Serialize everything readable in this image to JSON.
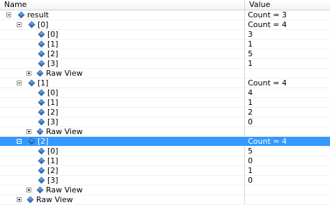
{
  "columns": {
    "name": "Name",
    "value": "Value"
  },
  "rows": [
    {
      "label": "result",
      "value": "Count = 3",
      "level": 0,
      "expander": "minus"
    },
    {
      "label": "[0]",
      "value": "Count = 4",
      "level": 1,
      "expander": "minus"
    },
    {
      "label": "[0]",
      "value": "3",
      "level": 2,
      "expander": ""
    },
    {
      "label": "[1]",
      "value": "1",
      "level": 2,
      "expander": ""
    },
    {
      "label": "[2]",
      "value": "5",
      "level": 2,
      "expander": ""
    },
    {
      "label": "[3]",
      "value": "1",
      "level": 2,
      "expander": ""
    },
    {
      "label": "Raw View",
      "value": "",
      "level": 2,
      "expander": "plus",
      "raw": true
    },
    {
      "label": "[1]",
      "value": "Count = 4",
      "level": 1,
      "expander": "minus"
    },
    {
      "label": "[0]",
      "value": "4",
      "level": 2,
      "expander": ""
    },
    {
      "label": "[1]",
      "value": "1",
      "level": 2,
      "expander": ""
    },
    {
      "label": "[2]",
      "value": "2",
      "level": 2,
      "expander": ""
    },
    {
      "label": "[3]",
      "value": "0",
      "level": 2,
      "expander": ""
    },
    {
      "label": "Raw View",
      "value": "",
      "level": 2,
      "expander": "plus",
      "raw": true
    },
    {
      "label": "[2]",
      "value": "Count = 4",
      "level": 1,
      "expander": "minus",
      "selected": true
    },
    {
      "label": "[0]",
      "value": "5",
      "level": 2,
      "expander": ""
    },
    {
      "label": "[1]",
      "value": "0",
      "level": 2,
      "expander": ""
    },
    {
      "label": "[2]",
      "value": "1",
      "level": 2,
      "expander": ""
    },
    {
      "label": "[3]",
      "value": "0",
      "level": 2,
      "expander": ""
    },
    {
      "label": "Raw View",
      "value": "",
      "level": 2,
      "expander": "plus",
      "raw": true
    },
    {
      "label": "Raw View",
      "value": "",
      "level": 1,
      "expander": "plus",
      "raw": true
    }
  ],
  "colors": {
    "selection": "#3399ff",
    "grid_line": "#d5d5d5",
    "icon": "#2a6fc0"
  },
  "icon_names": {
    "expand": "expand-icon",
    "collapse": "collapse-icon",
    "field": "field-icon"
  }
}
